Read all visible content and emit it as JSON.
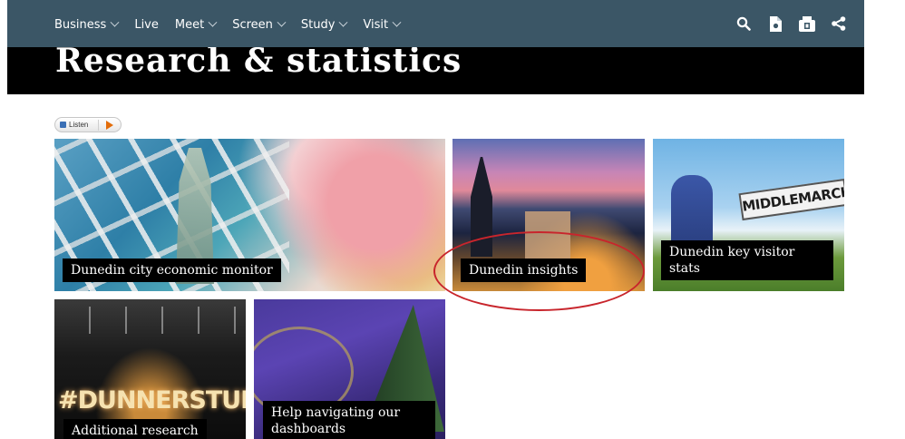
{
  "nav": {
    "items": [
      {
        "label": "Business",
        "dropdown": true
      },
      {
        "label": "Live",
        "dropdown": false
      },
      {
        "label": "Meet",
        "dropdown": true
      },
      {
        "label": "Screen",
        "dropdown": true
      },
      {
        "label": "Study",
        "dropdown": true
      },
      {
        "label": "Visit",
        "dropdown": true
      }
    ],
    "icons": [
      "search-icon",
      "document-icon",
      "print-icon",
      "share-icon"
    ]
  },
  "page": {
    "title": "Research & statistics"
  },
  "listen": {
    "label": "Listen"
  },
  "tiles": [
    {
      "label": "Dunedin city economic monitor"
    },
    {
      "label": "Dunedin insights"
    },
    {
      "label": "Dunedin key visitor stats"
    },
    {
      "label": "Additional research"
    },
    {
      "label": "Help navigating our dashboards"
    }
  ],
  "images": {
    "sign_text": "MIDDLEMARCH",
    "neon_text": "#DUNNERSTUNNE"
  },
  "colors": {
    "nav_bg": "#3b5666",
    "title_bg": "#000000",
    "annotation": "#c8252c"
  }
}
